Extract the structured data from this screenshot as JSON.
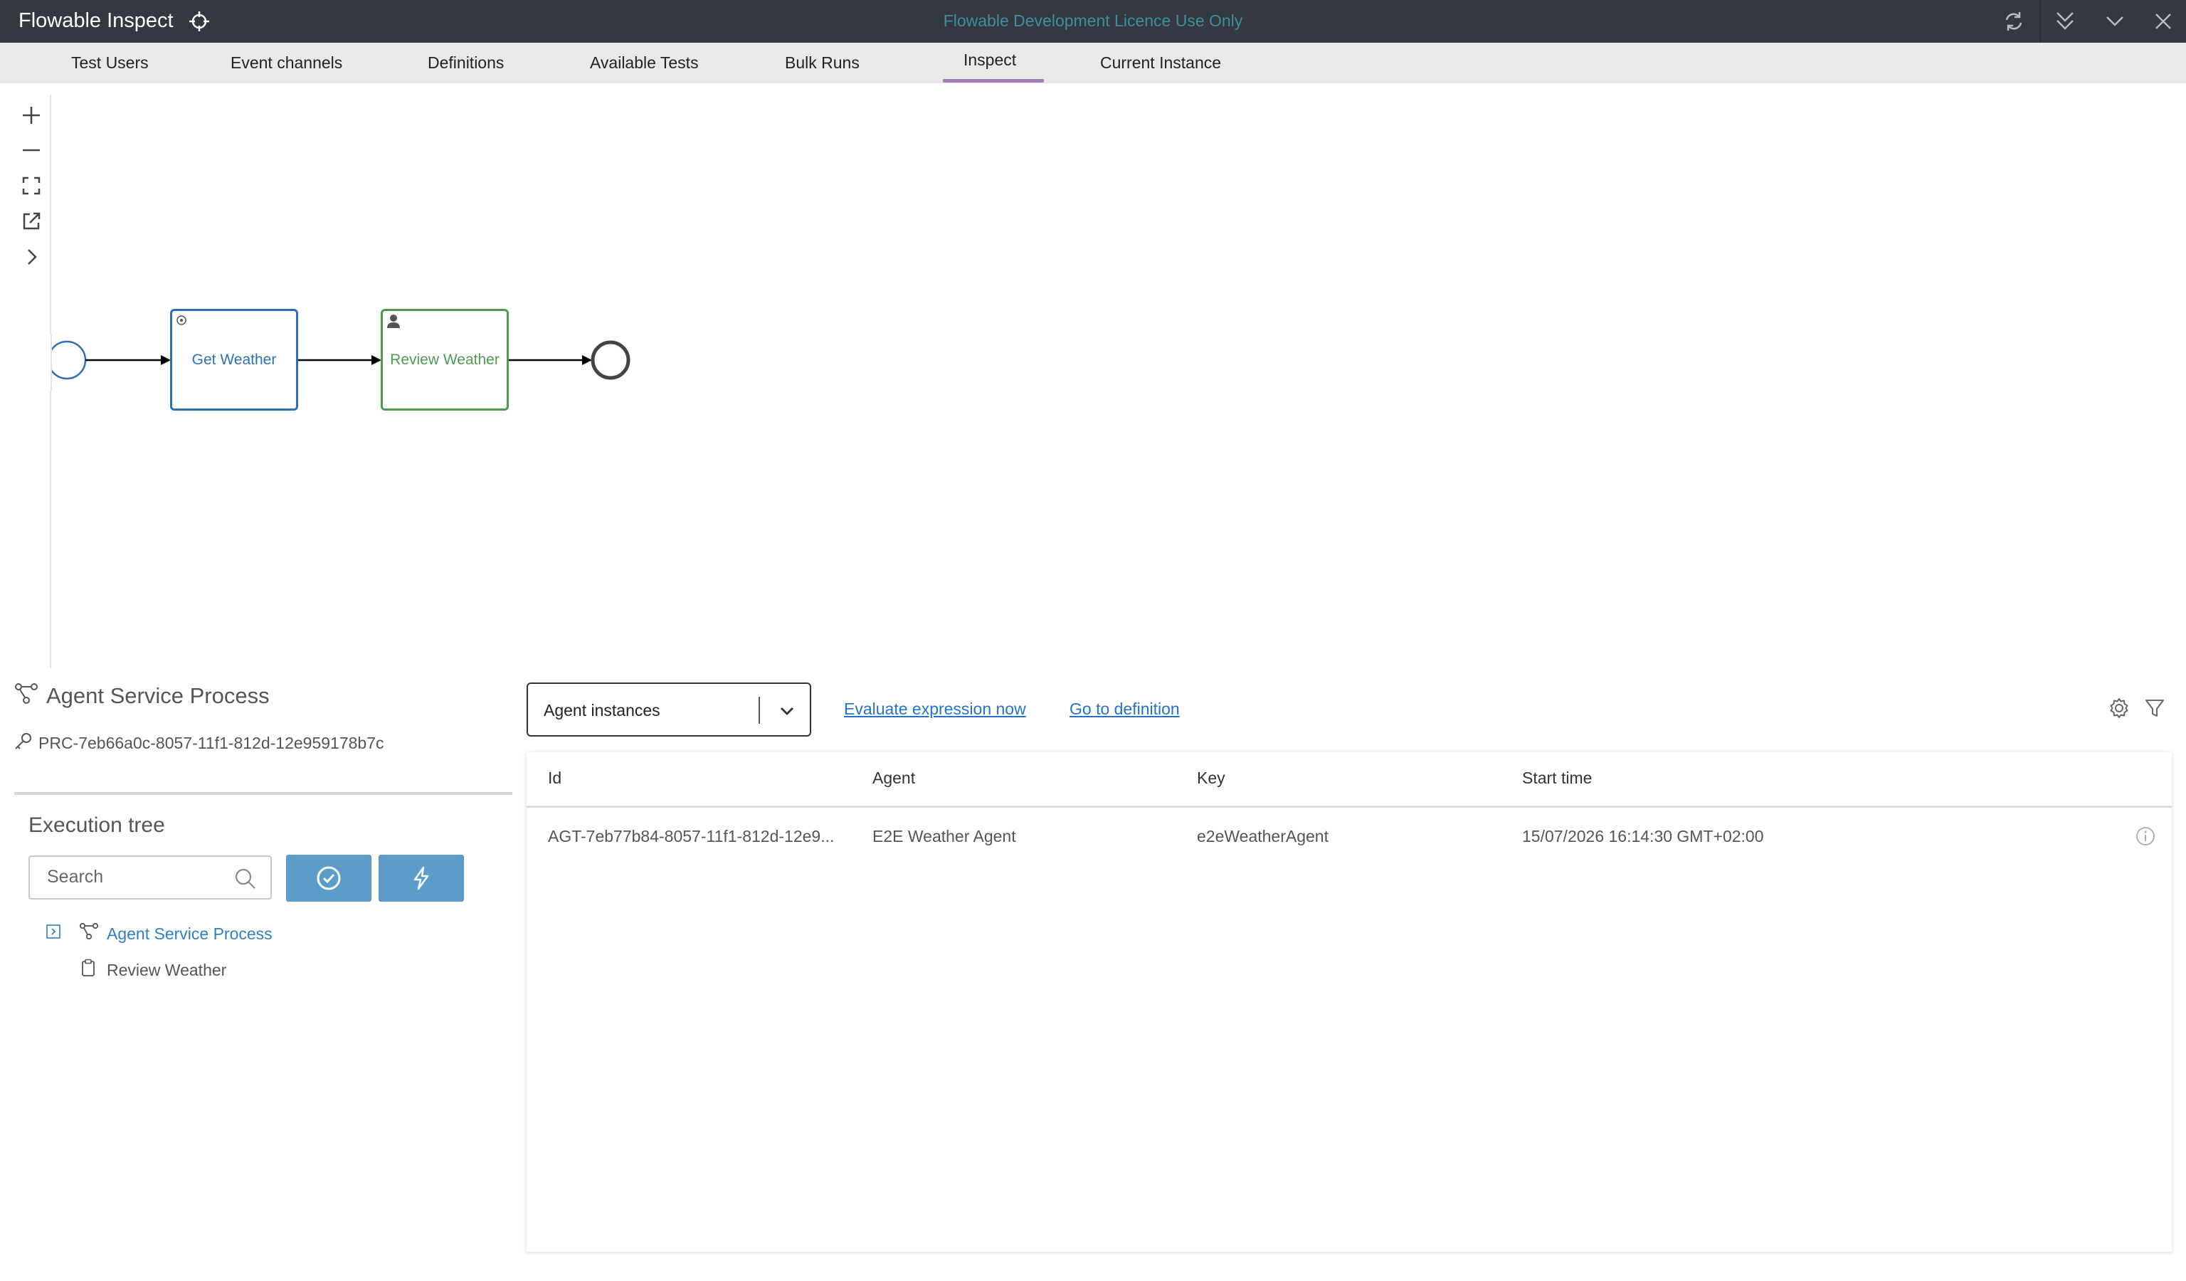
{
  "titlebar": {
    "app_title": "Flowable Inspect",
    "licence_text": "Flowable Development Licence Use Only",
    "icons": [
      "target-icon",
      "refresh-icon",
      "double-chevron-down-icon",
      "chevron-down-icon",
      "close-icon"
    ]
  },
  "tabs": {
    "items": [
      "Test Users",
      "Event channels",
      "Definitions",
      "Available Tests",
      "Bulk Runs",
      "Inspect",
      "Current Instance"
    ],
    "active": "Inspect",
    "accent_color": "#a67cb8"
  },
  "diagram": {
    "toolbar_icons": [
      "zoom-in-icon",
      "zoom-out-icon",
      "fit-screen-icon",
      "open-external-icon",
      "chevron-right-icon"
    ],
    "nodes": {
      "service_task": "Get Weather",
      "user_task": "Review Weather"
    },
    "colors": {
      "service_task": "#2f6fb3",
      "user_task": "#4e9a4e"
    }
  },
  "process": {
    "title": "Agent Service Process",
    "id": "PRC-7eb66a0c-8057-11f1-812d-12e959178b7c"
  },
  "execution_tree": {
    "title": "Execution tree",
    "search_placeholder": "Search",
    "nodes": [
      {
        "label": "Agent Service Process",
        "type": "process"
      },
      {
        "label": "Review Weather",
        "type": "task"
      }
    ]
  },
  "right_panel": {
    "select_value": "Agent instances",
    "links": {
      "evaluate": "Evaluate expression now",
      "go_to_definition": "Go to definition"
    },
    "table": {
      "columns": [
        "Id",
        "Agent",
        "Key",
        "Start time"
      ],
      "rows": [
        [
          "AGT-7eb77b84-8057-11f1-812d-12e9...",
          "E2E Weather Agent",
          "e2eWeatherAgent",
          "15/07/2026 16:14:30 GMT+02:00"
        ]
      ]
    }
  }
}
